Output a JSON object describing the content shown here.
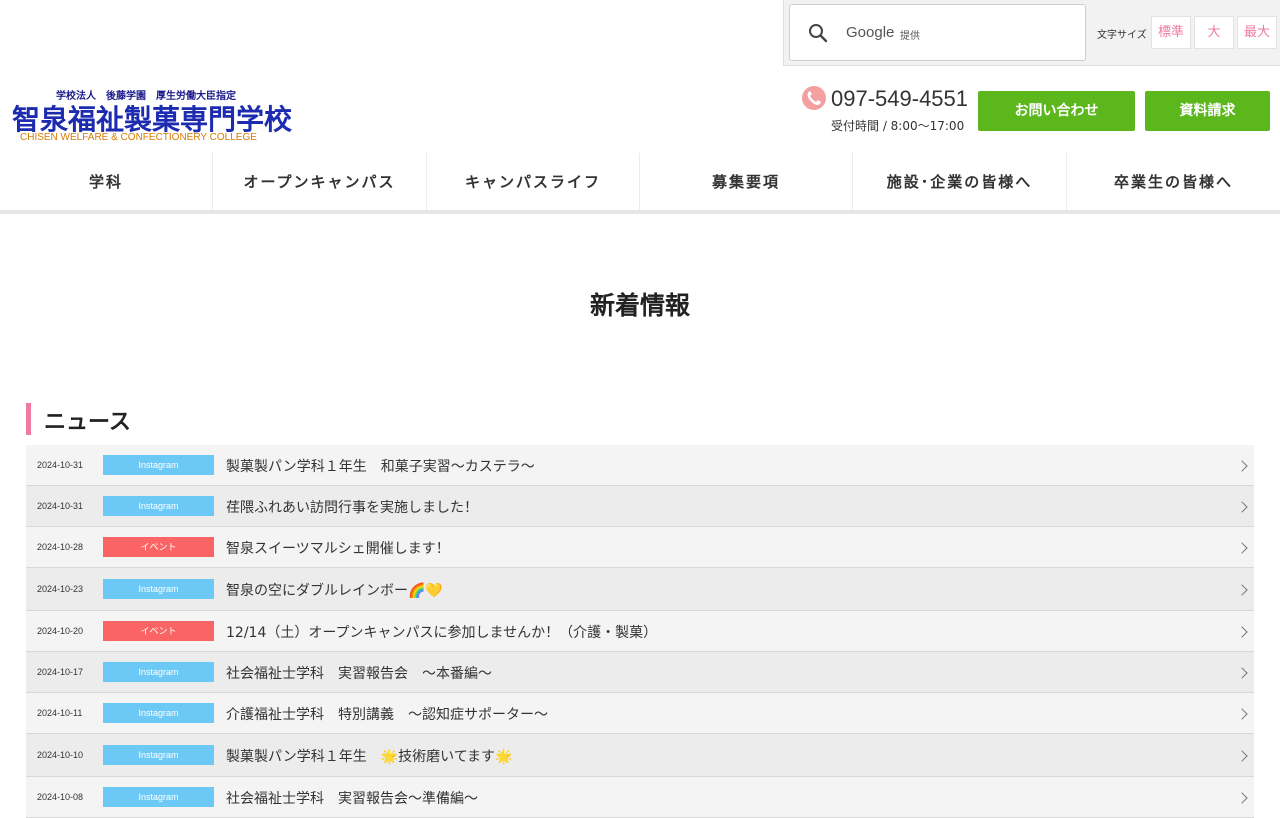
{
  "search": {
    "provider": "Google",
    "provided_label": "提供"
  },
  "font_size": {
    "label": "文字サイズ",
    "options": [
      "標準",
      "大",
      "最大"
    ]
  },
  "logo": {
    "subtitle": "学校法人　後藤学園　厚生労働大臣指定",
    "name": "智泉福祉製菓専門学校",
    "english": "CHISEN WELFARE & CONFECTIONERY COLLEGE"
  },
  "contact": {
    "phone": "097-549-4551",
    "hours": "受付時間 / 8:00〜17:00",
    "inquiry_label": "お問い合わせ",
    "request_label": "資料請求"
  },
  "nav": [
    "学科",
    "オープンキャンパス",
    "キャンパスライフ",
    "募集要項",
    "施設･企業の皆様へ",
    "卒業生の皆様へ"
  ],
  "page_title": "新着情報",
  "section_title": "ニュース",
  "colors": {
    "instagram": "#6cc8f5",
    "event": "#fb6464",
    "accent_green": "#5cb71d",
    "accent_pink": "#f07aa0"
  },
  "news": [
    {
      "date": "2024-10-31",
      "category": "Instagram",
      "type": "instagram",
      "title": "製菓製パン学科１年生　和菓子実習〜カステラ〜"
    },
    {
      "date": "2024-10-31",
      "category": "Instagram",
      "type": "instagram",
      "title": "荏隈ふれあい訪問行事を実施しました！"
    },
    {
      "date": "2024-10-28",
      "category": "イベント",
      "type": "event",
      "title": "智泉スイーツマルシェ開催します！"
    },
    {
      "date": "2024-10-23",
      "category": "Instagram",
      "type": "instagram",
      "title": "智泉の空にダブルレインボー🌈💛"
    },
    {
      "date": "2024-10-20",
      "category": "イベント",
      "type": "event",
      "title": "12/14（土）オープンキャンパスに参加しませんか！（介護・製菓）"
    },
    {
      "date": "2024-10-17",
      "category": "Instagram",
      "type": "instagram",
      "title": "社会福祉士学科　実習報告会　〜本番編〜"
    },
    {
      "date": "2024-10-11",
      "category": "Instagram",
      "type": "instagram",
      "title": "介護福祉士学科　特別講義　〜認知症サポーター〜"
    },
    {
      "date": "2024-10-10",
      "category": "Instagram",
      "type": "instagram",
      "title": "製菓製パン学科１年生　🌟技術磨いてます🌟"
    },
    {
      "date": "2024-10-08",
      "category": "Instagram",
      "type": "instagram",
      "title": "社会福祉士学科　実習報告会〜準備編〜"
    }
  ]
}
